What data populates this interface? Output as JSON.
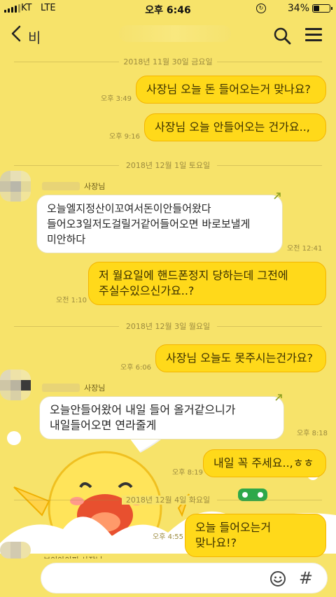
{
  "status_bar": {
    "carrier": "KT",
    "network": "LTE",
    "time": "오후 6:46",
    "battery": "34%",
    "battery_level": 0.34
  },
  "header": {
    "back_icon": "chevron-left-icon",
    "room_name": "비",
    "search_icon": "search-icon",
    "menu_icon": "menu-icon"
  },
  "chat": {
    "dates": [
      "2018년 11월 30일 금요일",
      "2018년 12월 1일 토요일",
      "2018년 12월 3일 월요일",
      "2018년 12월 4일 화요일"
    ],
    "sender_name": "사장님",
    "sender_name_full": "브이아이피 사장님",
    "messages": [
      {
        "side": "sent",
        "text": "사장님 오늘 돈 들어오는거 맞나요?",
        "time": "오후 3:49"
      },
      {
        "side": "sent",
        "text": "사장님 오늘 안들어오는 건가요..,",
        "time": "오후 9:16"
      },
      {
        "side": "recv",
        "text": "오늘엘지정산이꼬여서돈이안들어왔다 들어오3일저도걸릴거같어들어오면 바로보낼게  미안하다",
        "time": "오전 12:41"
      },
      {
        "side": "sent",
        "text": "저 월요일에 핸드폰정지 당하는데 그전에 주실수있으신가요..?",
        "time": "오전 1:10"
      },
      {
        "side": "sent",
        "text": "사장님 오늘도 못주시는건가요?",
        "time": "오후 6:06"
      },
      {
        "side": "recv",
        "text": "오늘안들어왔어 내일 들어 올거같으니가 내일들어오면 연라줄게",
        "time": "오후 8:18"
      },
      {
        "side": "sent",
        "text": "내일 꼭 주세요..,ㅎㅎ",
        "time": "오후 8:19"
      },
      {
        "side": "sent",
        "text": "오늘 들어오는거 맞나요!?",
        "time": "오후 4:55"
      }
    ]
  },
  "input_bar": {
    "emoji_icon": "emoji-icon",
    "hash_icon": "hash-icon",
    "hash_label": "#"
  },
  "colors": {
    "background": "#f7e36a",
    "sent_bubble": "#ffd91a",
    "received_bubble": "#ffffff"
  }
}
